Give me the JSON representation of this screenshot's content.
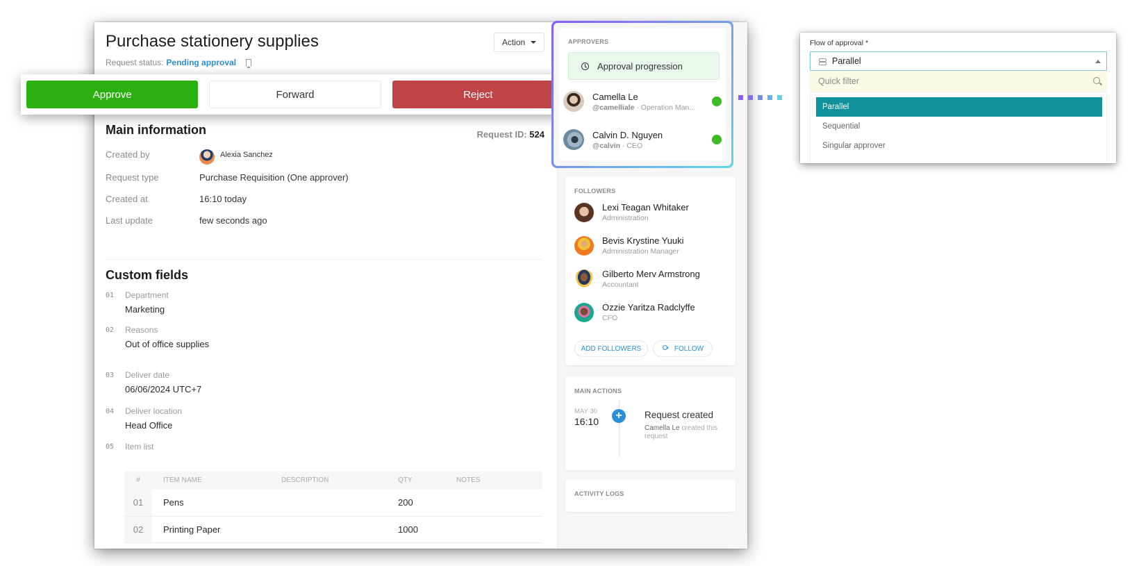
{
  "request": {
    "title": "Purchase stationery supplies",
    "status_label": "Request status:",
    "status_value": "Pending approval",
    "action_button": "Action"
  },
  "action_bar": {
    "approve": "Approve",
    "forward": "Forward",
    "reject": "Reject"
  },
  "main_info": {
    "title": "Main information",
    "request_id_label": "Request ID:",
    "request_id": "524",
    "rows": [
      {
        "label": "Created by",
        "value": "Alexia Sanchez"
      },
      {
        "label": "Request type",
        "value": "Purchase Requisition  (One approver)"
      },
      {
        "label": "Created at",
        "value": "16:10 today"
      },
      {
        "label": "Last update",
        "value": "few seconds ago"
      }
    ]
  },
  "custom_fields": {
    "title": "Custom fields",
    "fields": [
      {
        "num": "01",
        "label": "Department",
        "value": "Marketing"
      },
      {
        "num": "02",
        "label": "Reasons",
        "value": "Out of office supplies"
      },
      {
        "num": "03",
        "label": "Deliver date",
        "value": "06/06/2024 UTC+7"
      },
      {
        "num": "04",
        "label": "Deliver location",
        "value": "Head Office"
      },
      {
        "num": "05",
        "label": "Item list",
        "value": ""
      }
    ],
    "item_table": {
      "columns": [
        "#",
        "ITEM NAME",
        "DESCRIPTION",
        "QTY",
        "NOTES"
      ],
      "rows": [
        {
          "num": "01",
          "name": "Pens",
          "description": "",
          "qty": "200",
          "notes": ""
        },
        {
          "num": "02",
          "name": "Printing Paper",
          "description": "",
          "qty": "1000",
          "notes": ""
        }
      ]
    }
  },
  "approvers": {
    "title": "APPROVERS",
    "progression_label": "Approval progression",
    "people": [
      {
        "name": "Camella Le",
        "handle": "@camelliale",
        "role": "Operation Man...",
        "status": "approved"
      },
      {
        "name": "Calvin D. Nguyen",
        "handle": "@calvin",
        "role": "CEO",
        "status": "approved"
      }
    ]
  },
  "followers": {
    "title": "FOLLOWERS",
    "people": [
      {
        "name": "Lexi Teagan Whitaker",
        "role": "Administration"
      },
      {
        "name": "Bevis Krystine Yuuki",
        "role": "Administration Manager"
      },
      {
        "name": "Gilberto Merv Armstrong",
        "role": "Accountant"
      },
      {
        "name": "Ozzie Yaritza Radclyffe",
        "role": "CFO"
      }
    ],
    "add_button": "ADD FOLLOWERS",
    "follow_button": "FOLLOW"
  },
  "main_actions": {
    "title": "MAIN ACTIONS",
    "events": [
      {
        "date": "MAY 30",
        "time": "16:10",
        "title": "Request created",
        "actor": "Camella Le",
        "description": "created this request"
      }
    ]
  },
  "activity_logs": {
    "title": "ACTIVITY LOGS"
  },
  "flow_dropdown": {
    "label": "Flow of approval *",
    "selected": "Parallel",
    "filter_placeholder": "Quick filter",
    "options": [
      "Parallel",
      "Sequential",
      "Singular approver"
    ]
  },
  "colors": {
    "approve": "#2bb010",
    "reject": "#c04445",
    "link": "#2b8fd6",
    "selected_option": "#11929a",
    "online": "#3dbb25",
    "highlight_gradient_start": "#8a5cf5",
    "highlight_gradient_end": "#5fd8e6"
  }
}
